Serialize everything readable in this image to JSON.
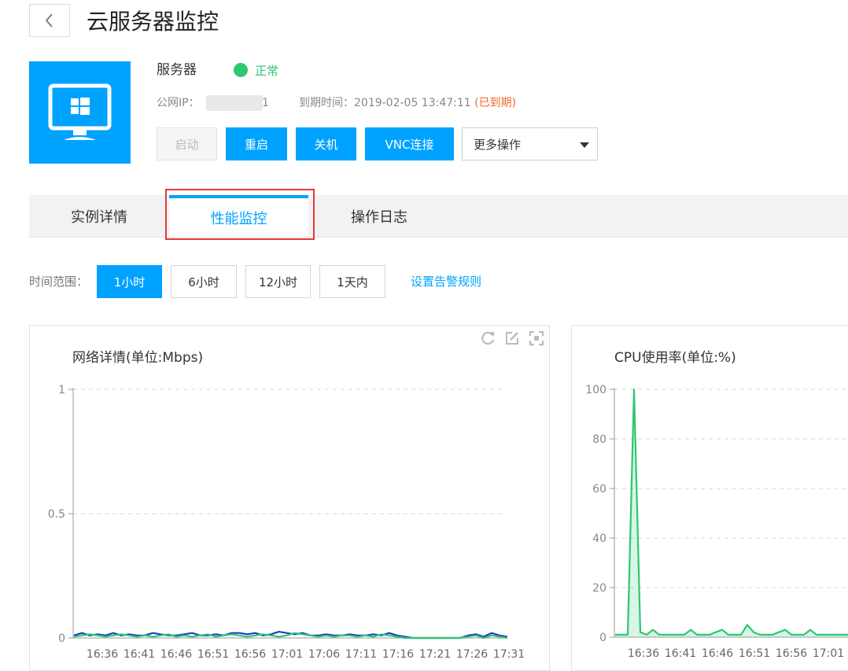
{
  "header": {
    "title": "云服务器监控"
  },
  "server": {
    "name": "服务器",
    "status": "正常",
    "ip_label": "公网IP：",
    "ip_tail": "1",
    "expire_label": "到期时间：2019-02-05 13:47:11 ",
    "expire_status": "(已到期)"
  },
  "actions": {
    "start": "启动",
    "restart": "重启",
    "shutdown": "关机",
    "vnc": "VNC连接",
    "more": "更多操作"
  },
  "tabs": [
    {
      "label": "实例详情",
      "active": false
    },
    {
      "label": "性能监控",
      "active": true
    },
    {
      "label": "操作日志",
      "active": false
    }
  ],
  "time_range": {
    "label": "时间范围：",
    "options": [
      {
        "label": "1小时",
        "active": true
      },
      {
        "label": "6小时",
        "active": false
      },
      {
        "label": "12小时",
        "active": false
      },
      {
        "label": "1天内",
        "active": false
      }
    ],
    "alarm_link": "设置告警规则"
  },
  "colors": {
    "accent": "#00a2ff",
    "ok": "#2ec772",
    "warn": "#f06a1e",
    "in_series": "#1a3fcc",
    "out_series": "#2ec772"
  },
  "chart_data": [
    {
      "type": "line",
      "title": "网络详情(单位:Mbps)",
      "ylim": [
        0,
        1
      ],
      "yticks": [
        "0",
        "0.5",
        "1"
      ],
      "categories": [
        "16:36",
        "16:41",
        "16:46",
        "16:51",
        "16:56",
        "17:01",
        "17:06",
        "17:11",
        "17:16",
        "17:21",
        "17:26",
        "17:31"
      ],
      "series": [
        {
          "values": [
            0.01,
            0.02,
            0.01,
            0.015,
            0.01,
            0.02,
            0.01,
            0.015,
            0.01,
            0.01,
            0.02,
            0.015,
            0.01,
            0.01,
            0.015,
            0.02,
            0.01,
            0.01,
            0.015,
            0.01,
            0.02,
            0.02,
            0.015,
            0.02,
            0.01,
            0.015,
            0.025,
            0.02,
            0.015,
            0.02,
            0.01,
            0.01,
            0.015,
            0.01,
            0.01,
            0.015,
            0.01,
            0.01,
            0.015,
            0.01,
            0.02,
            0.01,
            0.005,
            0.0,
            0.0,
            0.0,
            0.0,
            0.0,
            0.0,
            0.0,
            0.01,
            0.015,
            0.005,
            0.02,
            0.01,
            0.005
          ]
        },
        {
          "values": [
            0.005,
            0.01,
            0.015,
            0.01,
            0.005,
            0.01,
            0.015,
            0.01,
            0.005,
            0.01,
            0.005,
            0.01,
            0.015,
            0.005,
            0.01,
            0.005,
            0.01,
            0.015,
            0.005,
            0.01,
            0.015,
            0.01,
            0.005,
            0.01,
            0.015,
            0.01,
            0.005,
            0.01,
            0.02,
            0.015,
            0.01,
            0.005,
            0.01,
            0.005,
            0.01,
            0.01,
            0.005,
            0.01,
            0.005,
            0.015,
            0.01,
            0.005,
            0.0,
            0.0,
            0.0,
            0.0,
            0.0,
            0.0,
            0.0,
            0.0,
            0.005,
            0.01,
            0.0,
            0.01,
            0.005,
            0.0
          ]
        }
      ]
    },
    {
      "type": "area",
      "title": "CPU使用率(单位:%)",
      "ylim": [
        0,
        100
      ],
      "yticks": [
        "0",
        "20",
        "40",
        "60",
        "80",
        "100"
      ],
      "categories": [
        "16:36",
        "16:41",
        "16:46",
        "16:51",
        "16:56",
        "17:01"
      ],
      "series": [
        {
          "values": [
            1,
            1,
            1,
            100,
            2,
            1,
            3,
            1,
            1,
            1,
            1,
            1,
            3,
            1,
            1,
            1,
            2,
            3,
            1,
            1,
            1,
            5,
            2,
            1,
            1,
            1,
            2,
            3,
            1,
            1,
            1,
            3,
            1,
            1,
            1,
            1,
            1,
            1
          ]
        }
      ]
    }
  ]
}
